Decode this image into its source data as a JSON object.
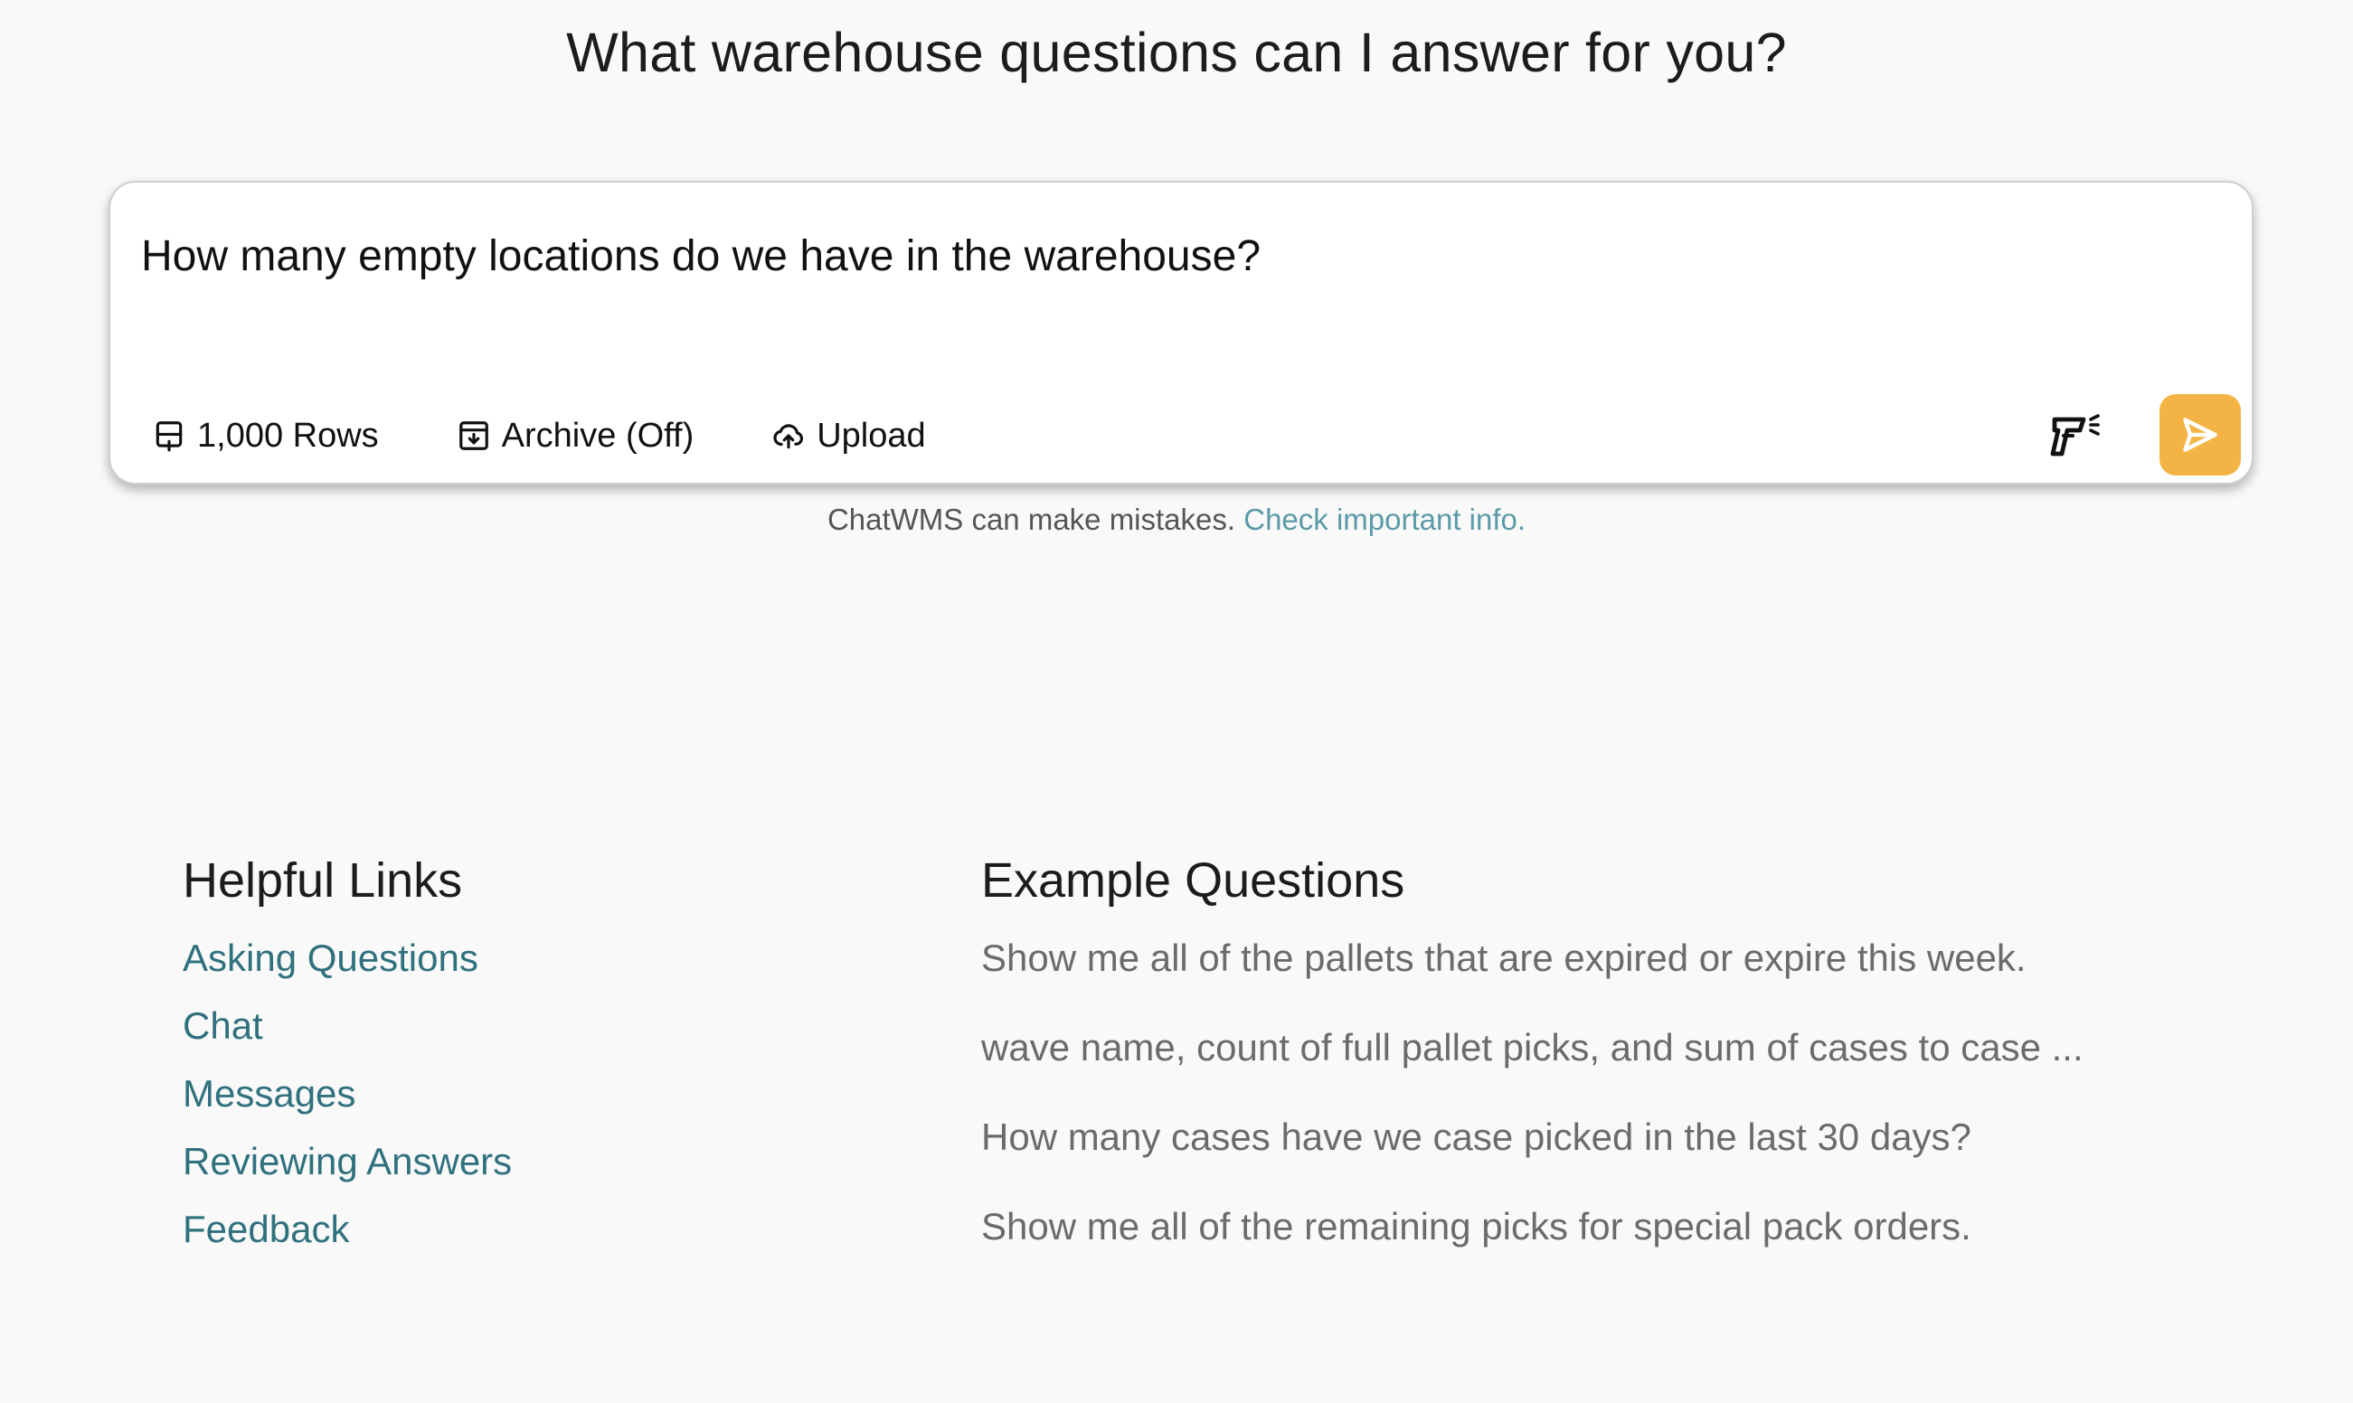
{
  "header": {
    "title": "What warehouse questions can I answer for you?"
  },
  "composer": {
    "query_value": "How many empty locations do we have in the warehouse?",
    "toolbar": {
      "rows_label": "1,000 Rows",
      "archive_label": "Archive (Off)",
      "upload_label": "Upload"
    },
    "icons": {
      "rows": "rows-icon",
      "archive": "archive-icon",
      "upload": "cloud-upload-icon",
      "scanner": "barcode-scanner-icon",
      "send": "send-icon"
    },
    "send_color": "#f3b445"
  },
  "disclaimer": {
    "text": "ChatWMS can make mistakes.",
    "link_text": "Check important info."
  },
  "helpful_links": {
    "heading": "Helpful Links",
    "items": [
      "Asking Questions",
      "Chat",
      "Messages",
      "Reviewing Answers",
      "Feedback"
    ]
  },
  "example_questions": {
    "heading": "Example Questions",
    "items": [
      "Show me all of the pallets that are expired or expire this week.",
      "wave name, count of full pallet picks, and sum of cases to case ...",
      "How many cases have we case picked in the last 30 days?",
      "Show me all of the remaining picks for special pack orders."
    ]
  },
  "colors": {
    "link": "#2f717d",
    "disclaimer_link": "#5b9aa7",
    "accent": "#f3b445",
    "background": "#f9f9f9"
  }
}
